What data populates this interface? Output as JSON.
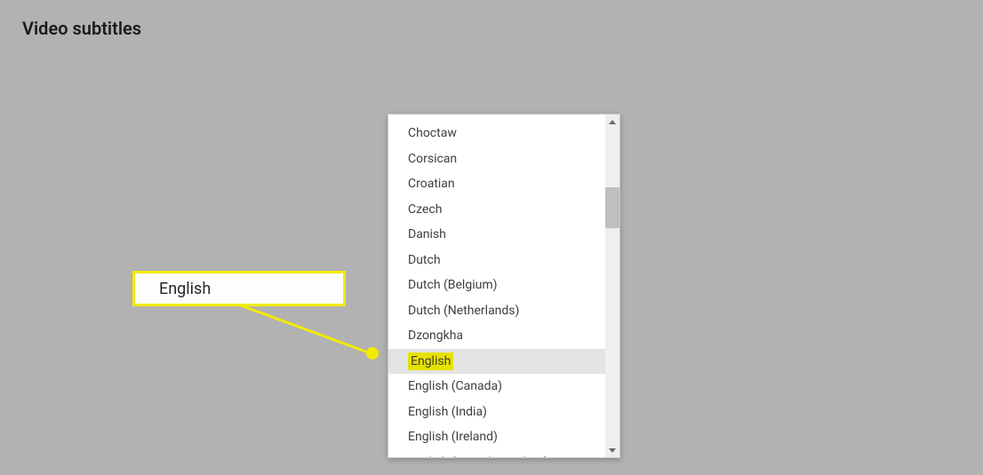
{
  "page_title": "Video subtitles",
  "callout_text": "English",
  "dropdown": {
    "items": [
      {
        "label": "Choctaw"
      },
      {
        "label": "Corsican"
      },
      {
        "label": "Croatian"
      },
      {
        "label": "Czech"
      },
      {
        "label": "Danish"
      },
      {
        "label": "Dutch"
      },
      {
        "label": "Dutch (Belgium)"
      },
      {
        "label": "Dutch (Netherlands)"
      },
      {
        "label": "Dzongkha"
      },
      {
        "label": "English",
        "hovered": true,
        "highlighted": true
      },
      {
        "label": "English (Canada)"
      },
      {
        "label": "English (India)"
      },
      {
        "label": "English (Ireland)"
      },
      {
        "label": "English (United Kingdom)"
      }
    ]
  },
  "arrow_color": "#f3ea00",
  "highlight_color": "#e6e200"
}
